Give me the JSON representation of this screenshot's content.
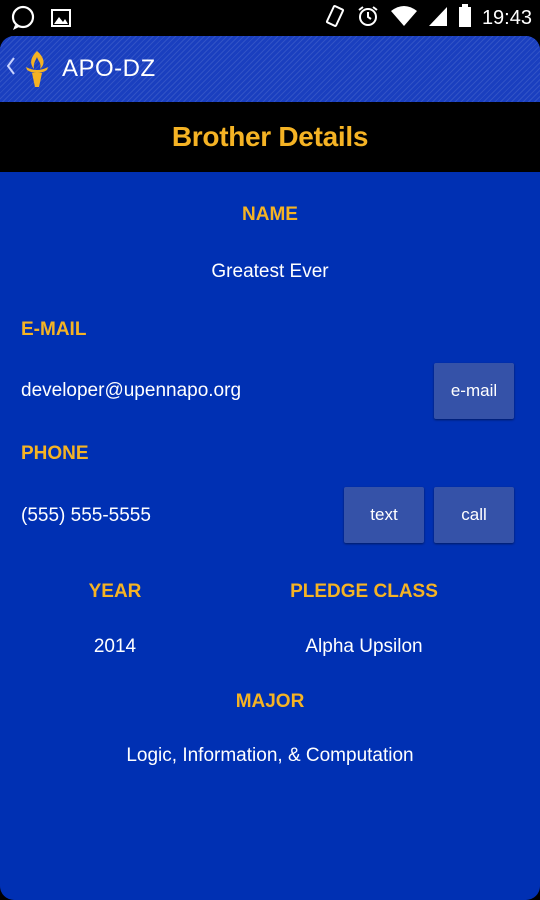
{
  "status_bar": {
    "time": "19:43",
    "left_icons": [
      "chat-bubble-icon",
      "image-icon"
    ],
    "right_icons": [
      "vibrate-icon",
      "alarm-icon",
      "wifi-icon",
      "signal-icon",
      "battery-icon"
    ]
  },
  "action_bar": {
    "title": "APO-DZ",
    "back_icon": "chevron-left-icon",
    "logo_icon": "torch-logo-icon"
  },
  "header": {
    "title": "Brother Details"
  },
  "details": {
    "name_label": "NAME",
    "name_value": "Greatest Ever",
    "email_label": "E-MAIL",
    "email_value": "developer@upennapo.org",
    "email_button": "e-mail",
    "phone_label": "PHONE",
    "phone_value": "(555) 555-5555",
    "text_button": "text",
    "call_button": "call",
    "year_label": "YEAR",
    "year_value": "2014",
    "pledge_label": "PLEDGE CLASS",
    "pledge_value": "Alpha Upsilon",
    "major_label": "MAJOR",
    "major_value": "Logic, Information, & Computation"
  },
  "colors": {
    "background": "#0030b3",
    "accent": "#f5b324",
    "button": "#3552a8",
    "header_band": "#000000"
  }
}
